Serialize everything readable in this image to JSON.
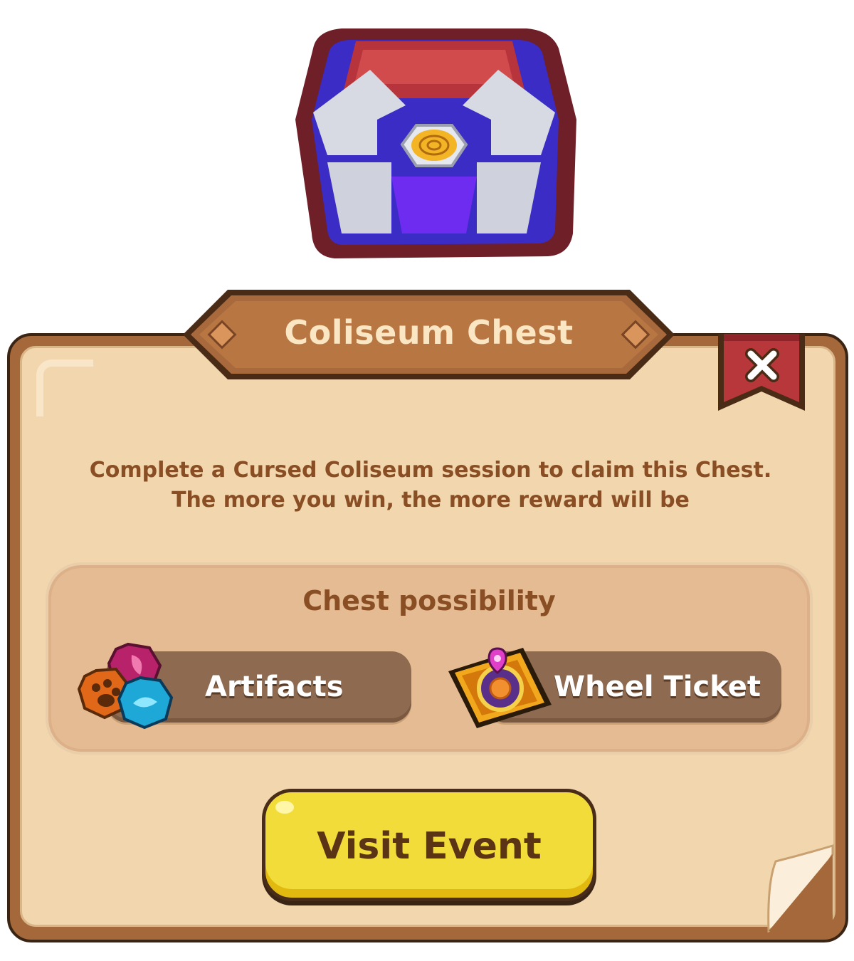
{
  "title": "Coliseum Chest",
  "description_line1": "Complete a Cursed Coliseum session to claim this Chest.",
  "description_line2": "The more you win, the more reward will be",
  "possibility": {
    "title": "Chest possibility",
    "items": [
      {
        "label": "Artifacts",
        "icon": "artifacts-icon"
      },
      {
        "label": "Wheel Ticket",
        "icon": "wheel-ticket-icon"
      }
    ]
  },
  "button": {
    "label": "Visit Event"
  },
  "icons": {
    "close": "close-icon",
    "chest": "coliseum-chest-icon"
  },
  "colors": {
    "panel": "#f1d6ae",
    "frame": "#a4683a",
    "banner": "#a8693c",
    "text_brown": "#8a4e24",
    "ribbon": "#b8373a",
    "button": "#f1dc3a"
  }
}
